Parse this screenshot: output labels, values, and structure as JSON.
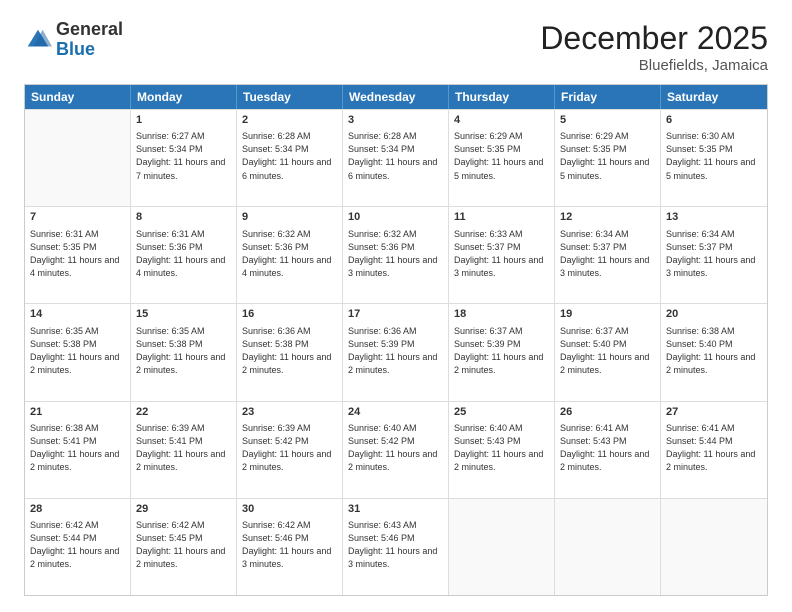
{
  "logo": {
    "general": "General",
    "blue": "Blue"
  },
  "header": {
    "month": "December 2025",
    "location": "Bluefields, Jamaica"
  },
  "weekdays": [
    "Sunday",
    "Monday",
    "Tuesday",
    "Wednesday",
    "Thursday",
    "Friday",
    "Saturday"
  ],
  "rows": [
    [
      {
        "day": "",
        "sunrise": "",
        "sunset": "",
        "daylight": "",
        "empty": true
      },
      {
        "day": "1",
        "sunrise": "Sunrise: 6:27 AM",
        "sunset": "Sunset: 5:34 PM",
        "daylight": "Daylight: 11 hours and 7 minutes.",
        "empty": false
      },
      {
        "day": "2",
        "sunrise": "Sunrise: 6:28 AM",
        "sunset": "Sunset: 5:34 PM",
        "daylight": "Daylight: 11 hours and 6 minutes.",
        "empty": false
      },
      {
        "day": "3",
        "sunrise": "Sunrise: 6:28 AM",
        "sunset": "Sunset: 5:34 PM",
        "daylight": "Daylight: 11 hours and 6 minutes.",
        "empty": false
      },
      {
        "day": "4",
        "sunrise": "Sunrise: 6:29 AM",
        "sunset": "Sunset: 5:35 PM",
        "daylight": "Daylight: 11 hours and 5 minutes.",
        "empty": false
      },
      {
        "day": "5",
        "sunrise": "Sunrise: 6:29 AM",
        "sunset": "Sunset: 5:35 PM",
        "daylight": "Daylight: 11 hours and 5 minutes.",
        "empty": false
      },
      {
        "day": "6",
        "sunrise": "Sunrise: 6:30 AM",
        "sunset": "Sunset: 5:35 PM",
        "daylight": "Daylight: 11 hours and 5 minutes.",
        "empty": false
      }
    ],
    [
      {
        "day": "7",
        "sunrise": "Sunrise: 6:31 AM",
        "sunset": "Sunset: 5:35 PM",
        "daylight": "Daylight: 11 hours and 4 minutes.",
        "empty": false
      },
      {
        "day": "8",
        "sunrise": "Sunrise: 6:31 AM",
        "sunset": "Sunset: 5:36 PM",
        "daylight": "Daylight: 11 hours and 4 minutes.",
        "empty": false
      },
      {
        "day": "9",
        "sunrise": "Sunrise: 6:32 AM",
        "sunset": "Sunset: 5:36 PM",
        "daylight": "Daylight: 11 hours and 4 minutes.",
        "empty": false
      },
      {
        "day": "10",
        "sunrise": "Sunrise: 6:32 AM",
        "sunset": "Sunset: 5:36 PM",
        "daylight": "Daylight: 11 hours and 3 minutes.",
        "empty": false
      },
      {
        "day": "11",
        "sunrise": "Sunrise: 6:33 AM",
        "sunset": "Sunset: 5:37 PM",
        "daylight": "Daylight: 11 hours and 3 minutes.",
        "empty": false
      },
      {
        "day": "12",
        "sunrise": "Sunrise: 6:34 AM",
        "sunset": "Sunset: 5:37 PM",
        "daylight": "Daylight: 11 hours and 3 minutes.",
        "empty": false
      },
      {
        "day": "13",
        "sunrise": "Sunrise: 6:34 AM",
        "sunset": "Sunset: 5:37 PM",
        "daylight": "Daylight: 11 hours and 3 minutes.",
        "empty": false
      }
    ],
    [
      {
        "day": "14",
        "sunrise": "Sunrise: 6:35 AM",
        "sunset": "Sunset: 5:38 PM",
        "daylight": "Daylight: 11 hours and 2 minutes.",
        "empty": false
      },
      {
        "day": "15",
        "sunrise": "Sunrise: 6:35 AM",
        "sunset": "Sunset: 5:38 PM",
        "daylight": "Daylight: 11 hours and 2 minutes.",
        "empty": false
      },
      {
        "day": "16",
        "sunrise": "Sunrise: 6:36 AM",
        "sunset": "Sunset: 5:38 PM",
        "daylight": "Daylight: 11 hours and 2 minutes.",
        "empty": false
      },
      {
        "day": "17",
        "sunrise": "Sunrise: 6:36 AM",
        "sunset": "Sunset: 5:39 PM",
        "daylight": "Daylight: 11 hours and 2 minutes.",
        "empty": false
      },
      {
        "day": "18",
        "sunrise": "Sunrise: 6:37 AM",
        "sunset": "Sunset: 5:39 PM",
        "daylight": "Daylight: 11 hours and 2 minutes.",
        "empty": false
      },
      {
        "day": "19",
        "sunrise": "Sunrise: 6:37 AM",
        "sunset": "Sunset: 5:40 PM",
        "daylight": "Daylight: 11 hours and 2 minutes.",
        "empty": false
      },
      {
        "day": "20",
        "sunrise": "Sunrise: 6:38 AM",
        "sunset": "Sunset: 5:40 PM",
        "daylight": "Daylight: 11 hours and 2 minutes.",
        "empty": false
      }
    ],
    [
      {
        "day": "21",
        "sunrise": "Sunrise: 6:38 AM",
        "sunset": "Sunset: 5:41 PM",
        "daylight": "Daylight: 11 hours and 2 minutes.",
        "empty": false
      },
      {
        "day": "22",
        "sunrise": "Sunrise: 6:39 AM",
        "sunset": "Sunset: 5:41 PM",
        "daylight": "Daylight: 11 hours and 2 minutes.",
        "empty": false
      },
      {
        "day": "23",
        "sunrise": "Sunrise: 6:39 AM",
        "sunset": "Sunset: 5:42 PM",
        "daylight": "Daylight: 11 hours and 2 minutes.",
        "empty": false
      },
      {
        "day": "24",
        "sunrise": "Sunrise: 6:40 AM",
        "sunset": "Sunset: 5:42 PM",
        "daylight": "Daylight: 11 hours and 2 minutes.",
        "empty": false
      },
      {
        "day": "25",
        "sunrise": "Sunrise: 6:40 AM",
        "sunset": "Sunset: 5:43 PM",
        "daylight": "Daylight: 11 hours and 2 minutes.",
        "empty": false
      },
      {
        "day": "26",
        "sunrise": "Sunrise: 6:41 AM",
        "sunset": "Sunset: 5:43 PM",
        "daylight": "Daylight: 11 hours and 2 minutes.",
        "empty": false
      },
      {
        "day": "27",
        "sunrise": "Sunrise: 6:41 AM",
        "sunset": "Sunset: 5:44 PM",
        "daylight": "Daylight: 11 hours and 2 minutes.",
        "empty": false
      }
    ],
    [
      {
        "day": "28",
        "sunrise": "Sunrise: 6:42 AM",
        "sunset": "Sunset: 5:44 PM",
        "daylight": "Daylight: 11 hours and 2 minutes.",
        "empty": false
      },
      {
        "day": "29",
        "sunrise": "Sunrise: 6:42 AM",
        "sunset": "Sunset: 5:45 PM",
        "daylight": "Daylight: 11 hours and 2 minutes.",
        "empty": false
      },
      {
        "day": "30",
        "sunrise": "Sunrise: 6:42 AM",
        "sunset": "Sunset: 5:46 PM",
        "daylight": "Daylight: 11 hours and 3 minutes.",
        "empty": false
      },
      {
        "day": "31",
        "sunrise": "Sunrise: 6:43 AM",
        "sunset": "Sunset: 5:46 PM",
        "daylight": "Daylight: 11 hours and 3 minutes.",
        "empty": false
      },
      {
        "day": "",
        "sunrise": "",
        "sunset": "",
        "daylight": "",
        "empty": true
      },
      {
        "day": "",
        "sunrise": "",
        "sunset": "",
        "daylight": "",
        "empty": true
      },
      {
        "day": "",
        "sunrise": "",
        "sunset": "",
        "daylight": "",
        "empty": true
      }
    ]
  ]
}
